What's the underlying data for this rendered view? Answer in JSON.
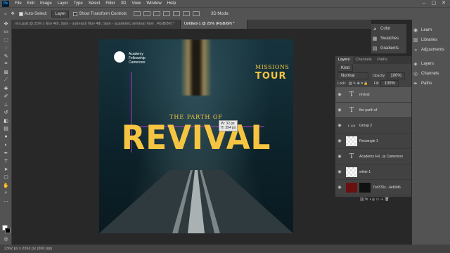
{
  "menubar": {
    "app_logo": "Ps",
    "items": [
      "File",
      "Edit",
      "Image",
      "Layer",
      "Type",
      "Select",
      "Filter",
      "3D",
      "View",
      "Window",
      "Help"
    ],
    "window_controls": [
      "–",
      "▢",
      "✕"
    ]
  },
  "options": {
    "auto_select_label": "Auto-Select:",
    "auto_select_value": "Layer",
    "transform_label": "Show Transform Controls",
    "mode_3d": "3D Mode:"
  },
  "tabs": [
    {
      "label": "ers.psd @ 25% ( Nov 4th, 9am - outreach  Nov 4th, 9am - academic seminar  Nov , RGB/8#) *",
      "active": false
    },
    {
      "label": "Untitled-1 @ 25% (RGB/8#) *",
      "active": true
    }
  ],
  "artwork": {
    "org_name_lines": [
      "Academy",
      "Fellowship",
      "Cameroon"
    ],
    "missions": "MISSIONS",
    "tour": "TOUR",
    "parth": "THE PARTH OF",
    "revival": "REVIVAL",
    "accent": "#f5c542"
  },
  "measure_tip": {
    "w": "W: 32 px",
    "h": "H: 394 px"
  },
  "right_icons": {
    "small": [
      "Color",
      "Swatches",
      "Gradients"
    ],
    "big": [
      "Learn",
      "Libraries",
      "Adjustments",
      "Layers",
      "Channels",
      "Paths"
    ]
  },
  "layers_panel": {
    "tabs": [
      "Layers",
      "Channels",
      "Paths"
    ],
    "kind": "Kind",
    "blend": "Normal",
    "opacity_label": "Opacity:",
    "opacity": "100%",
    "lock_label": "Lock:",
    "fill_label": "Fill:",
    "fill": "100%",
    "layers": [
      {
        "name": "revival",
        "type": "text",
        "selected": true
      },
      {
        "name": "the parth of",
        "type": "text",
        "selected": true
      },
      {
        "name": "Group 2",
        "type": "group",
        "selected": false
      },
      {
        "name": "Rectangle 1",
        "type": "shape",
        "selected": false
      },
      {
        "name": "Academy Fel...ip Cameroon",
        "type": "text",
        "selected": false
      },
      {
        "name": "white-1",
        "type": "image",
        "selected": false
      },
      {
        "name": "7cd376c...4eb946",
        "type": "masked",
        "selected": false
      }
    ]
  },
  "status": {
    "doc_size": "2362 px x 2362 px (300 ppi)"
  }
}
